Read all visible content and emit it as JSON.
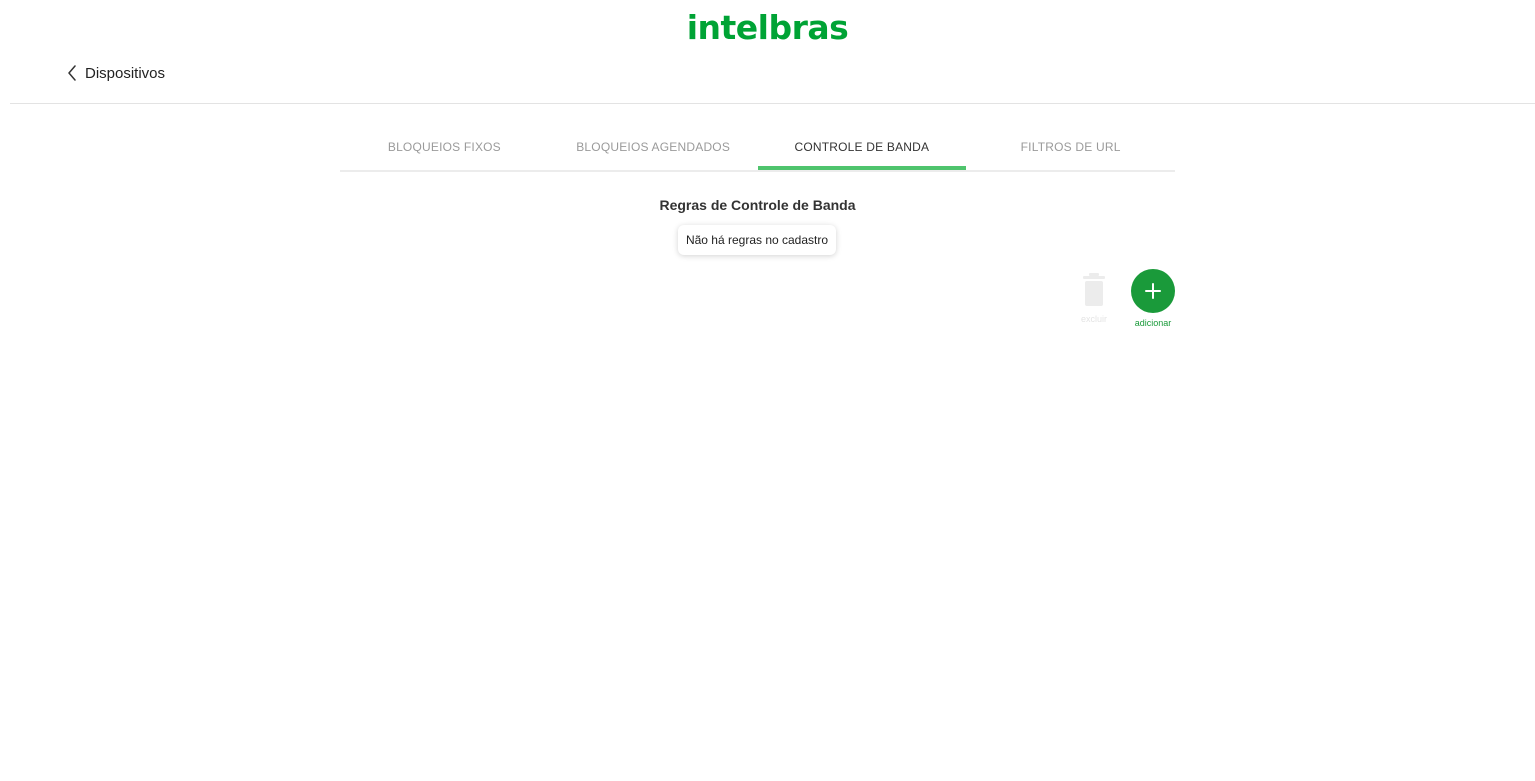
{
  "header": {
    "logo_text": "intelbras",
    "back_label": "Dispositivos"
  },
  "tabs": [
    {
      "label": "BLOQUEIOS FIXOS",
      "active": false
    },
    {
      "label": "BLOQUEIOS AGENDADOS",
      "active": false
    },
    {
      "label": "CONTROLE DE BANDA",
      "active": true
    },
    {
      "label": "FILTROS DE URL",
      "active": false
    }
  ],
  "section": {
    "title": "Regras de Controle de Banda",
    "empty_message": "Não há regras no cadastro"
  },
  "actions": {
    "delete_label": "excluir",
    "delete_enabled": false,
    "add_label": "adicionar",
    "add_enabled": true
  },
  "colors": {
    "brand_green": "#00a335",
    "tab_active_underline": "#4fc46d",
    "add_button": "#1a9a3a"
  }
}
